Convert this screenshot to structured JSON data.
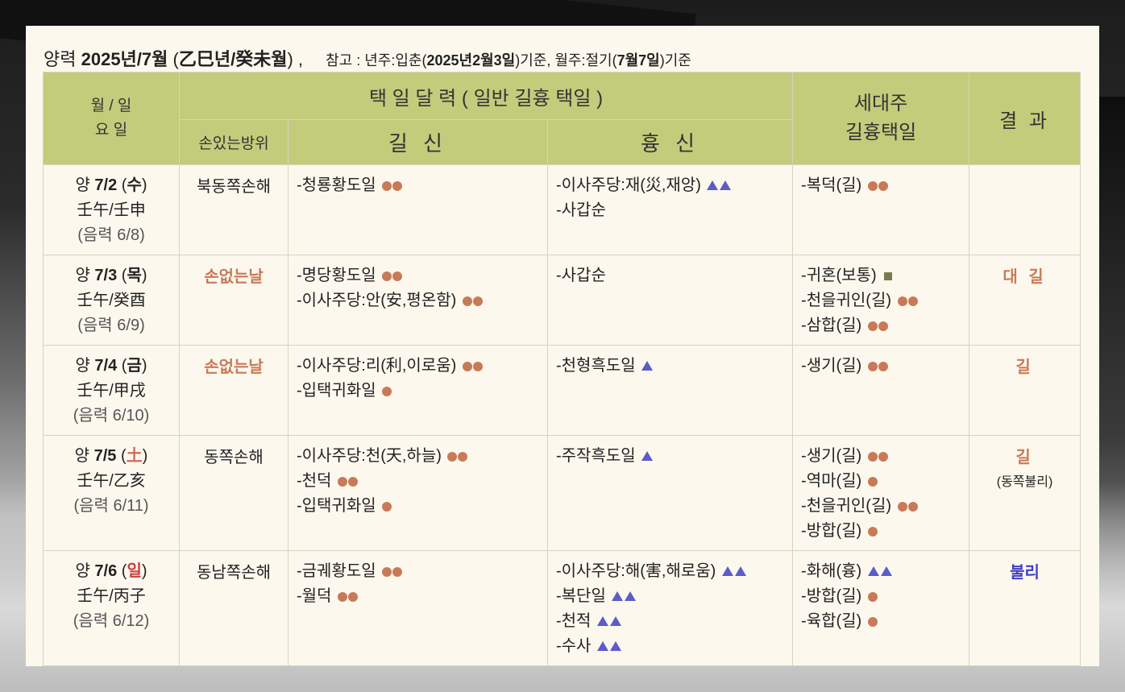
{
  "header": {
    "solar_prefix": "양력",
    "year_month": "2025년/7월",
    "ganji_open": "(",
    "ganji": "乙巳년/癸未월",
    "ganji_close": ") ,",
    "ref_label": "참고 : 년주:입춘(",
    "ref_date1": "2025년2월3일",
    "ref_mid": ")기준,   월주:절기(",
    "ref_date2": "7월7일",
    "ref_end": ")기준"
  },
  "columns": {
    "date_line1": "월 / 일",
    "date_line2": "요 일",
    "main_group": "택 일 달 력 ( 일반 길흉 택일 )",
    "direction": "손있는방위",
    "gil": "길 신",
    "hyung": "흉 신",
    "sede_line1": "세대주",
    "sede_line2": "길흉택일",
    "result": "결 과"
  },
  "rows": [
    {
      "solar_pre": "양 ",
      "solar_date": "7/2",
      "weekday_open": " (",
      "weekday": "수",
      "weekday_close": ")",
      "weekday_type": "normal",
      "ganji": "壬午/壬申",
      "lunar": "(음력 6/8)",
      "direction": "북동쪽손해",
      "direction_nohand": false,
      "gil": [
        {
          "text": "-청룡황도일",
          "mark": "dot2"
        }
      ],
      "hyung": [
        {
          "text": "-이사주당:재(災,재앙)",
          "mark": "tri2"
        },
        {
          "text": "-사갑순",
          "mark": ""
        }
      ],
      "sede": [
        {
          "text": "-복덕(길)",
          "mark": "dot2"
        }
      ],
      "result": "",
      "result_type": "",
      "result_note": ""
    },
    {
      "solar_pre": "양 ",
      "solar_date": "7/3",
      "weekday_open": " (",
      "weekday": "목",
      "weekday_close": ")",
      "weekday_type": "normal",
      "ganji": "壬午/癸酉",
      "lunar": "(음력 6/9)",
      "direction": "손없는날",
      "direction_nohand": true,
      "gil": [
        {
          "text": "-명당황도일",
          "mark": "dot2"
        },
        {
          "text": "-이사주당:안(安,평온함)",
          "mark": "dot2"
        }
      ],
      "hyung": [
        {
          "text": "-사갑순",
          "mark": ""
        }
      ],
      "sede": [
        {
          "text": "-귀혼(보통)",
          "mark": "sq"
        },
        {
          "text": "-천을귀인(길)",
          "mark": "dot2"
        },
        {
          "text": "-삼합(길)",
          "mark": "dot2"
        }
      ],
      "result": "대 길",
      "result_type": "good",
      "result_note": ""
    },
    {
      "solar_pre": "양 ",
      "solar_date": "7/4",
      "weekday_open": " (",
      "weekday": "금",
      "weekday_close": ")",
      "weekday_type": "normal",
      "ganji": "壬午/甲戌",
      "lunar": "(음력 6/10)",
      "direction": "손없는날",
      "direction_nohand": true,
      "gil": [
        {
          "text": "-이사주당:리(利,이로움)",
          "mark": "dot2"
        },
        {
          "text": "-입택귀화일",
          "mark": "dot1"
        }
      ],
      "hyung": [
        {
          "text": "-천형흑도일",
          "mark": "tri1"
        }
      ],
      "sede": [
        {
          "text": "-생기(길)",
          "mark": "dot2"
        }
      ],
      "result": "길",
      "result_type": "good",
      "result_note": ""
    },
    {
      "solar_pre": "양 ",
      "solar_date": "7/5",
      "weekday_open": " (",
      "weekday": "土",
      "weekday_close": ")",
      "weekday_type": "sat",
      "ganji": "壬午/乙亥",
      "lunar": "(음력 6/11)",
      "direction": "동쪽손해",
      "direction_nohand": false,
      "gil": [
        {
          "text": "-이사주당:천(天,하늘)",
          "mark": "dot2"
        },
        {
          "text": "-천덕",
          "mark": "dot2"
        },
        {
          "text": "-입택귀화일",
          "mark": "dot1"
        }
      ],
      "hyung": [
        {
          "text": "-주작흑도일",
          "mark": "tri1"
        }
      ],
      "sede": [
        {
          "text": "-생기(길)",
          "mark": "dot2"
        },
        {
          "text": "-역마(길)",
          "mark": "dot1"
        },
        {
          "text": "-천을귀인(길)",
          "mark": "dot2"
        },
        {
          "text": "-방합(길)",
          "mark": "dot1"
        }
      ],
      "result": "길",
      "result_type": "good",
      "result_note": "(동쪽불리)"
    },
    {
      "solar_pre": "양 ",
      "solar_date": "7/6",
      "weekday_open": " (",
      "weekday": "일",
      "weekday_close": ")",
      "weekday_type": "sun",
      "ganji": "壬午/丙子",
      "lunar": "(음력 6/12)",
      "direction": "동남쪽손해",
      "direction_nohand": false,
      "gil": [
        {
          "text": "-금궤황도일",
          "mark": "dot2"
        },
        {
          "text": "-월덕",
          "mark": "dot2"
        }
      ],
      "hyung": [
        {
          "text": "-이사주당:해(害,해로움)",
          "mark": "tri2"
        },
        {
          "text": "-복단일",
          "mark": "tri2"
        },
        {
          "text": "-천적",
          "mark": "tri2"
        },
        {
          "text": "-수사",
          "mark": "tri2"
        }
      ],
      "sede": [
        {
          "text": "-화해(흉)",
          "mark": "tri2"
        },
        {
          "text": "-방합(길)",
          "mark": "dot1"
        },
        {
          "text": "-육합(길)",
          "mark": "dot1"
        }
      ],
      "result": "불리",
      "result_type": "bad",
      "result_note": ""
    }
  ],
  "marks": {
    "gil_color": "#c87a58",
    "hyung_color": "#5c5cc9",
    "neutral_color": "#7a7a4a"
  }
}
